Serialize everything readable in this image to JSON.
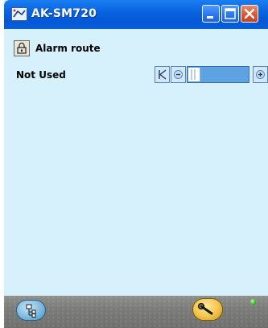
{
  "window": {
    "title": "AK-SM720",
    "controls": {
      "minimize": "minimize-icon",
      "maximize": "maximize-icon",
      "close": "close-icon"
    }
  },
  "header": {
    "label": "Alarm route"
  },
  "route": {
    "status": "Not Used"
  },
  "slider": {
    "first_icon": "skip-to-start-icon",
    "decrement_icon": "minus-icon",
    "increment_icon": "plus-icon"
  },
  "bottom": {
    "nav_icon": "tree-icon",
    "tool_icon": "wrench-icon",
    "status_color": "#3fbf2a"
  },
  "colors": {
    "titlebar": "#0a64e0",
    "background": "#d6f1fb",
    "close_button": "#dc5b3a"
  }
}
